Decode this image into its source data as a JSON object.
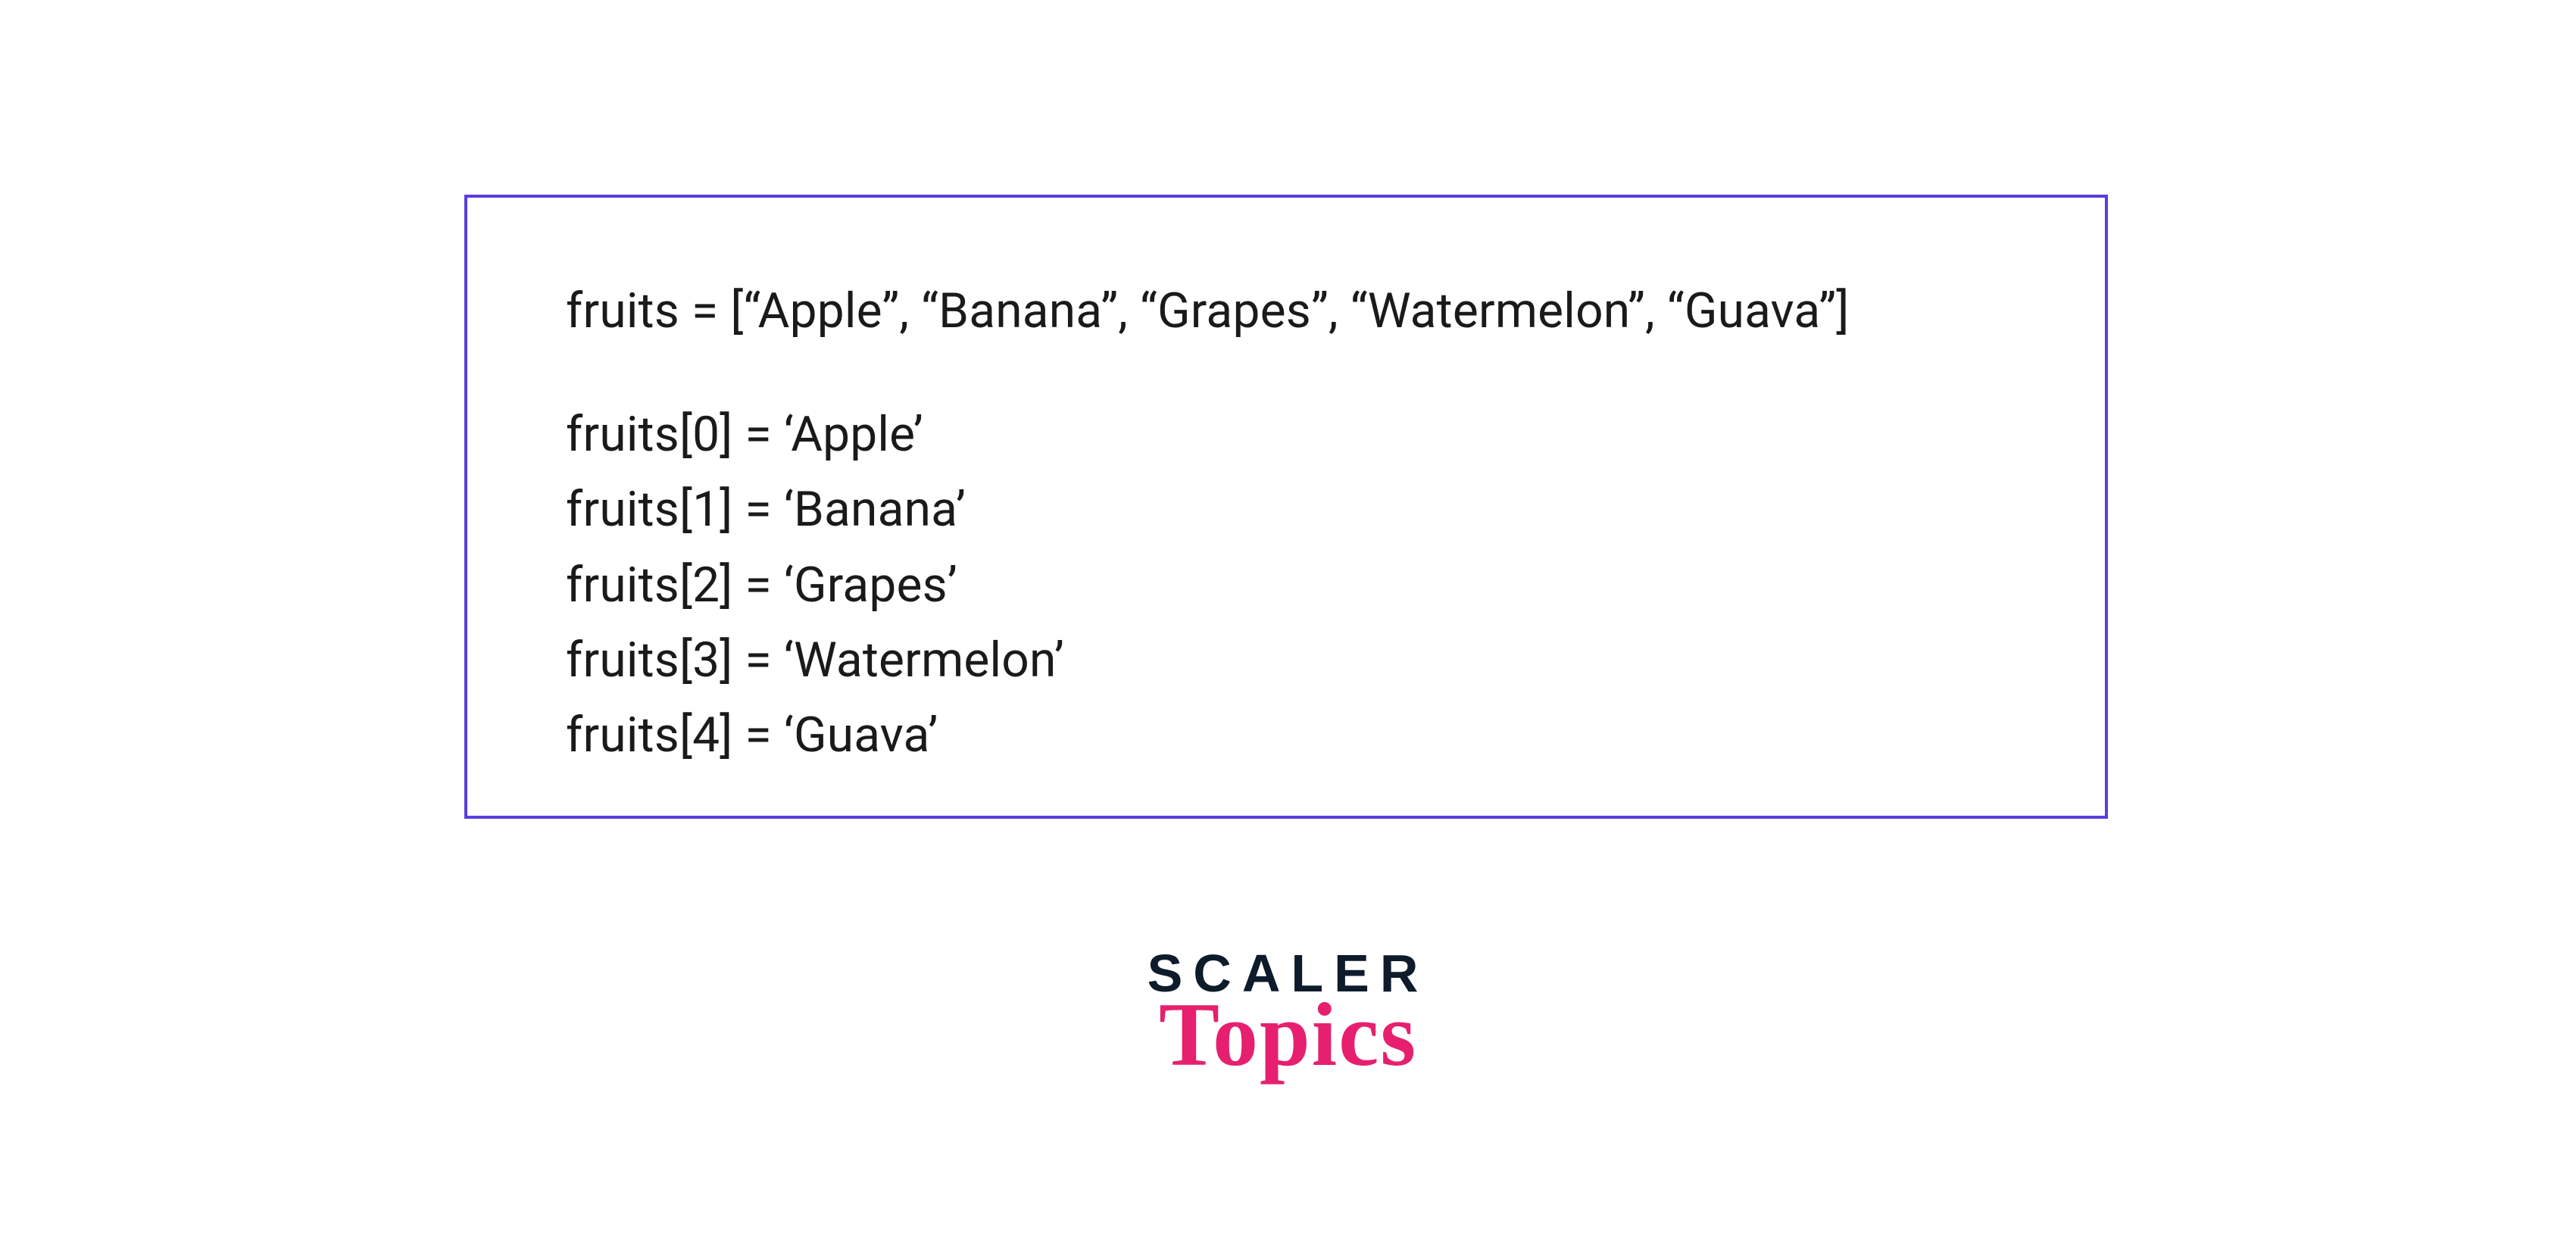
{
  "code": {
    "declaration": "fruits = [“Apple”, “Banana”, “Grapes”, “Watermelon”, “Guava”]",
    "lines": [
      "fruits[0] = ‘Apple’",
      "fruits[1] = ‘Banana’",
      "fruits[2] = ‘Grapes’",
      "fruits[3] = ‘Watermelon’",
      "fruits[4] = ‘Guava’"
    ]
  },
  "logo": {
    "line1": "SCALER",
    "line2": "Topics"
  },
  "colors": {
    "border": "#5b3de0",
    "text": "#1a1a1a",
    "logoDark": "#0d1b2a",
    "logoPink": "#e6206f"
  }
}
